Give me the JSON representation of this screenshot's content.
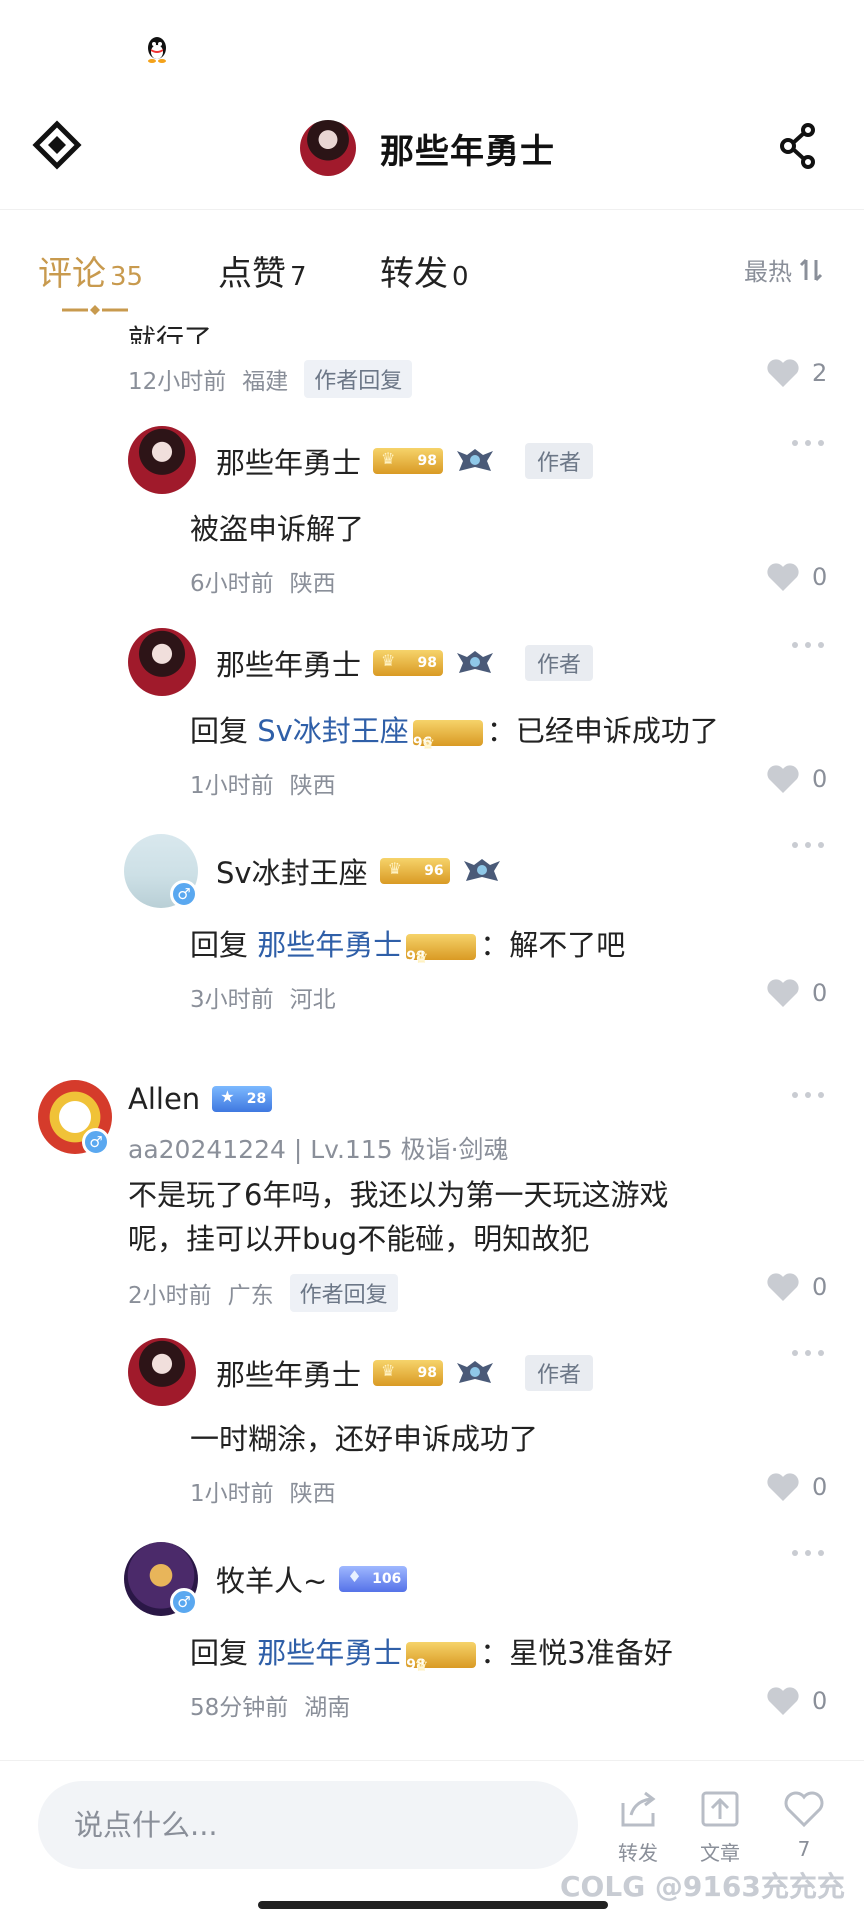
{
  "header": {
    "title": "那些年勇士"
  },
  "tabs": [
    {
      "label": "评论",
      "count": "35",
      "active": true
    },
    {
      "label": "点赞",
      "count": "7",
      "active": false
    },
    {
      "label": "转发",
      "count": "0",
      "active": false
    }
  ],
  "sort": {
    "label": "最热"
  },
  "top_fragment": {
    "text": "就行了",
    "time": "12小时前",
    "location": "福建",
    "tag": "作者回复",
    "likes": "2"
  },
  "replies_1": [
    {
      "name": "那些年勇士",
      "level": "98",
      "tag": "作者",
      "text": "被盗申诉解了",
      "time": "6小时前",
      "location": "陕西",
      "likes": "0"
    },
    {
      "name": "那些年勇士",
      "level": "98",
      "tag": "作者",
      "reply_prefix": "回复",
      "reply_to": "Sv冰封王座",
      "reply_to_level": "96",
      "text": "：已经申诉成功了",
      "time": "1小时前",
      "location": "陕西",
      "likes": "0"
    },
    {
      "name": "Sv冰封王座",
      "level": "96",
      "reply_prefix": "回复",
      "reply_to": "那些年勇士",
      "reply_to_level": "98",
      "text": "：解不了吧",
      "time": "3小时前",
      "location": "河北",
      "likes": "0"
    }
  ],
  "comment_allen": {
    "name": "Allen",
    "level": "28",
    "subtitle": "aa20241224 | Lv.115 极诣·剑魂",
    "text_line1": "不是玩了6年吗，我还以为第一天玩这游戏",
    "text_line2": "呢，挂可以开bug不能碰，明知故犯",
    "time": "2小时前",
    "location": "广东",
    "tag": "作者回复",
    "likes": "0"
  },
  "replies_2": [
    {
      "name": "那些年勇士",
      "level": "98",
      "tag": "作者",
      "text": "一时糊涂，还好申诉成功了",
      "time": "1小时前",
      "location": "陕西",
      "likes": "0"
    },
    {
      "name": "牧羊人~",
      "level": "106",
      "reply_prefix": "回复",
      "reply_to": "那些年勇士",
      "reply_to_level": "98",
      "text": "：星悦3准备好",
      "time": "58分钟前",
      "location": "湖南",
      "likes": "0"
    }
  ],
  "bottom": {
    "input_placeholder": "说点什么...",
    "share_label": "转发",
    "article_label": "文章",
    "like_count": "7",
    "watermark": "COLG @9163充充充"
  }
}
